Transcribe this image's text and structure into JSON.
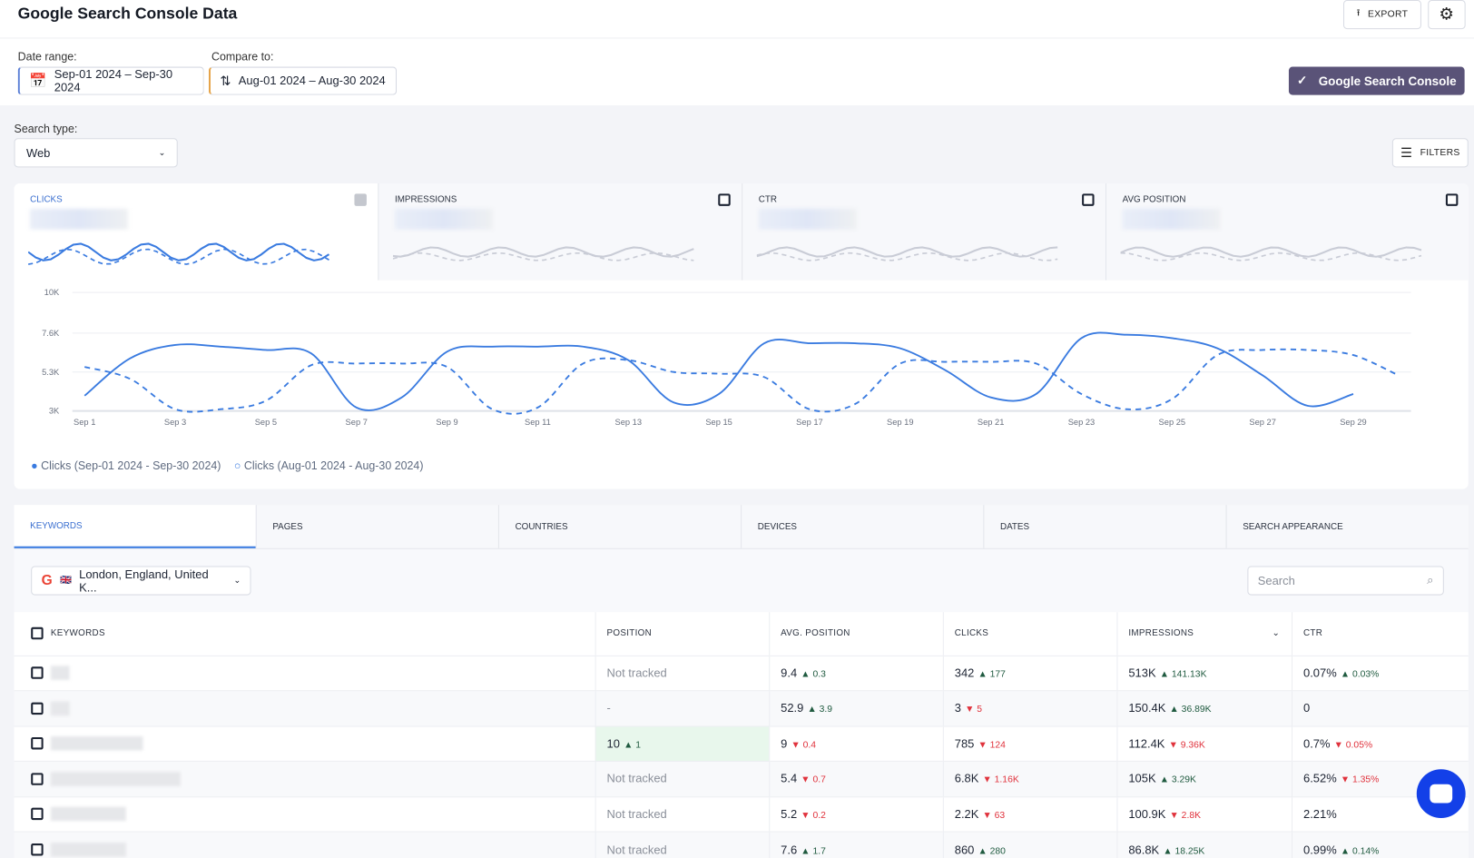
{
  "header": {
    "title": "Google Search Console Data",
    "export_label": "EXPORT"
  },
  "controls": {
    "date_range_label": "Date range:",
    "date_range": "Sep-01 2024 – Sep-30 2024",
    "compare_label": "Compare to:",
    "compare_range": "Aug-01 2024 – Aug-30 2024",
    "gsc_button": "Google Search Console",
    "search_type_label": "Search type:",
    "search_type": "Web",
    "filters_label": "FILTERS"
  },
  "metrics": [
    {
      "label": "CLICKS",
      "checked": true
    },
    {
      "label": "IMPRESSIONS",
      "checked": false
    },
    {
      "label": "CTR",
      "checked": false
    },
    {
      "label": "AVG POSITION",
      "checked": false
    }
  ],
  "colors": {
    "accent": "#3a7be0",
    "gsc_button": "#5a5378",
    "up": "#1f5a3f",
    "down": "#e0323c",
    "chat": "#1340e8"
  },
  "chart_data": {
    "type": "line",
    "y_ticks": [
      "3K",
      "5.3K",
      "7.6K",
      "10K"
    ],
    "ylim": [
      3000,
      10000
    ],
    "x_ticks": [
      "Sep 1",
      "Sep 3",
      "Sep 5",
      "Sep 7",
      "Sep 9",
      "Sep 11",
      "Sep 13",
      "Sep 15",
      "Sep 17",
      "Sep 19",
      "Sep 21",
      "Sep 23",
      "Sep 25",
      "Sep 27",
      "Sep 29"
    ],
    "grid": true,
    "legend_placement": "bottom-left",
    "series": [
      {
        "name": "Clicks (Sep-01 2024 - Sep-30 2024)",
        "style": "solid",
        "values": [
          3900,
          6100,
          6900,
          6800,
          6600,
          6400,
          3200,
          3800,
          6500,
          6800,
          6800,
          6800,
          6000,
          3500,
          4000,
          7000,
          7000,
          7000,
          6700,
          5400,
          3800,
          4000,
          7300,
          7500,
          7300,
          6700,
          5100,
          3300,
          4000
        ]
      },
      {
        "name": "Clicks (Aug-01 2024 - Aug-30 2024)",
        "style": "dashed",
        "values": [
          5600,
          4900,
          3100,
          3100,
          3600,
          5700,
          5800,
          5800,
          5600,
          3100,
          3200,
          5800,
          6000,
          5300,
          5200,
          5000,
          3100,
          3400,
          5800,
          5900,
          5900,
          5800,
          4000,
          3100,
          3700,
          6300,
          6600,
          6600,
          6300,
          5100
        ]
      }
    ]
  },
  "tabs": [
    "KEYWORDS",
    "PAGES",
    "COUNTRIES",
    "DEVICES",
    "DATES",
    "SEARCH APPEARANCE"
  ],
  "table": {
    "location": "London, England, United K...",
    "search_placeholder": "Search",
    "columns": [
      "KEYWORDS",
      "POSITION",
      "AVG. POSITION",
      "CLICKS",
      "IMPRESSIONS",
      "CTR"
    ],
    "rows": [
      {
        "position": "Not tracked",
        "avg": "9.4",
        "avg_d": "0.3",
        "avg_dir": "up",
        "clicks": "342",
        "clicks_d": "177",
        "clicks_dir": "up",
        "impr": "513K",
        "impr_d": "141.13K",
        "impr_dir": "up",
        "ctr": "0.07%",
        "ctr_d": "0.03%",
        "ctr_dir": "up"
      },
      {
        "position": "-",
        "avg": "52.9",
        "avg_d": "3.9",
        "avg_dir": "up",
        "clicks": "3",
        "clicks_d": "5",
        "clicks_dir": "down",
        "impr": "150.4K",
        "impr_d": "36.89K",
        "impr_dir": "up",
        "ctr": "0",
        "ctr_d": "",
        "ctr_dir": ""
      },
      {
        "position": "10",
        "position_d": "1",
        "avg": "9",
        "avg_d": "0.4",
        "avg_dir": "down",
        "clicks": "785",
        "clicks_d": "124",
        "clicks_dir": "down",
        "impr": "112.4K",
        "impr_d": "9.36K",
        "impr_dir": "down",
        "ctr": "0.7%",
        "ctr_d": "0.05%",
        "ctr_dir": "down"
      },
      {
        "position": "Not tracked",
        "avg": "5.4",
        "avg_d": "0.7",
        "avg_dir": "down",
        "clicks": "6.8K",
        "clicks_d": "1.16K",
        "clicks_dir": "down",
        "impr": "105K",
        "impr_d": "3.29K",
        "impr_dir": "up",
        "ctr": "6.52%",
        "ctr_d": "1.35%",
        "ctr_dir": "down"
      },
      {
        "position": "Not tracked",
        "avg": "5.2",
        "avg_d": "0.2",
        "avg_dir": "down",
        "clicks": "2.2K",
        "clicks_d": "63",
        "clicks_dir": "down",
        "impr": "100.9K",
        "impr_d": "2.8K",
        "impr_dir": "down",
        "ctr": "2.21%",
        "ctr_d": "",
        "ctr_dir": ""
      },
      {
        "position": "Not tracked",
        "avg": "7.6",
        "avg_d": "1.7",
        "avg_dir": "up",
        "clicks": "860",
        "clicks_d": "280",
        "clicks_dir": "up",
        "impr": "86.8K",
        "impr_d": "18.25K",
        "impr_dir": "up",
        "ctr": "0.99%",
        "ctr_d": "0.14%",
        "ctr_dir": "up"
      }
    ]
  }
}
